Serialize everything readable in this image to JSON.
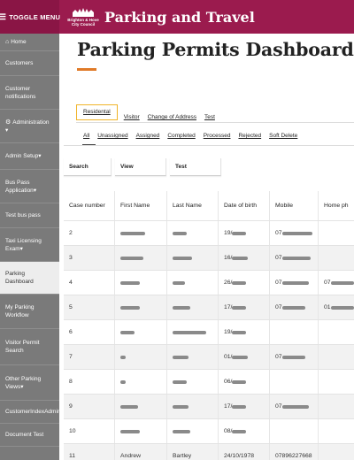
{
  "header": {
    "toggle_label": "TOGGLE MENU",
    "toggle_icon": "menu-icon",
    "logo_line1": "Brighton & Hove",
    "logo_line2": "City Council",
    "app_title": "Parking and Travel",
    "color": "#9b1b4e"
  },
  "sidebar": {
    "items": [
      {
        "label": "Home",
        "icon": "home-icon"
      },
      {
        "label": "Customers"
      },
      {
        "label": "Customer notifications"
      },
      {
        "label": "Administration",
        "icon": "gear-icon"
      },
      {
        "label": "Admin Setup"
      },
      {
        "label": "Bus Pass Application"
      },
      {
        "label": "Test bus pass"
      },
      {
        "label": "Taxi Licensing Exam"
      },
      {
        "label": "Parking Dashboard"
      },
      {
        "label": "My Parking Workflow"
      },
      {
        "label": "Visitor Permit Search"
      },
      {
        "label": "Other Parking Views"
      },
      {
        "label": "CustomerIndexAdmin"
      },
      {
        "label": "Document Test"
      }
    ],
    "caret": "▾"
  },
  "main": {
    "page_title": "Parking Permits Dashboard",
    "accent_color": "#e07a28",
    "tabs": [
      "Residental",
      "Visitor",
      "Change of Address",
      "Test"
    ],
    "active_tab": "Residental",
    "subtabs": [
      "All",
      "Unassigned",
      "Assigned",
      "Completed",
      "Processed",
      "Rejected",
      "Soft Delete"
    ],
    "active_subtab": "All",
    "filters": [
      "Search",
      "View",
      "Test"
    ]
  },
  "table": {
    "columns": [
      "Case number",
      "First Name",
      "Last Name",
      "Date of birth",
      "Mobile",
      "Home ph"
    ],
    "rows": [
      {
        "case": "2",
        "dob": "19/",
        "mobile": "07"
      },
      {
        "case": "3",
        "dob": "16/",
        "mobile": "07"
      },
      {
        "case": "4",
        "dob": "26/",
        "mobile": "07",
        "home": "07"
      },
      {
        "case": "5",
        "dob": "17/",
        "mobile": "07",
        "home": "01"
      },
      {
        "case": "6",
        "dob": "19/",
        "mobile": ""
      },
      {
        "case": "7",
        "dob": "01/",
        "mobile": "07"
      },
      {
        "case": "8",
        "dob": "06/",
        "mobile": ""
      },
      {
        "case": "9",
        "dob": "17/",
        "mobile": "07"
      },
      {
        "case": "10",
        "dob": "08/",
        "mobile": ""
      },
      {
        "case": "11",
        "first": "Andrew",
        "last": "Bartley",
        "dob": "24/10/1978",
        "mobile": "07896227668",
        "home": ""
      }
    ]
  }
}
